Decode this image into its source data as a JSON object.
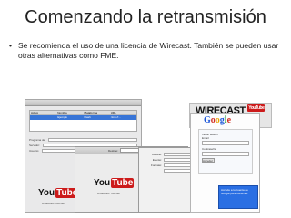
{
  "slide": {
    "title": "Comenzando la retransmisión",
    "bullet_symbol": "•",
    "bullet_text": "Se recomienda el uso de una licencia de Wirecast. También se pueden usar otras alternativas como FME."
  },
  "screens": {
    "back_window": {
      "columns": [
        "Activo",
        "Nombre",
        "Plataforma",
        "URL"
      ],
      "selected_row": [
        "",
        "Ejemplo",
        "Flash",
        "rtmp://..."
      ],
      "labels": [
        "Programa de:",
        "Servidor:",
        "Usuario:"
      ]
    },
    "youtube": {
      "logo_text": "You",
      "logo_tube": "Tube",
      "tagline": "Broadcast Yourself"
    },
    "mid_window": {
      "label": "Destino:"
    },
    "front_window": {
      "rows": [
        {
          "label": "Usuario:",
          "button": "Autenticar"
        },
        {
          "label": "Evento:",
          "button": ""
        },
        {
          "label": "Formato:",
          "button": ""
        },
        {
          "label": "",
          "button": ""
        }
      ]
    },
    "wirecast": {
      "logo": "WIRECAST",
      "badge": "YouTube"
    },
    "google": {
      "brand_letters": [
        "G",
        "o",
        "o",
        "g",
        "l",
        "e"
      ],
      "panel_title": "Iniciar sesión",
      "email_label": "Email",
      "password_label": "Contraseña",
      "login_button": "Acceder",
      "info_text": "Accede a tu cuenta de Google para transmitir"
    }
  }
}
